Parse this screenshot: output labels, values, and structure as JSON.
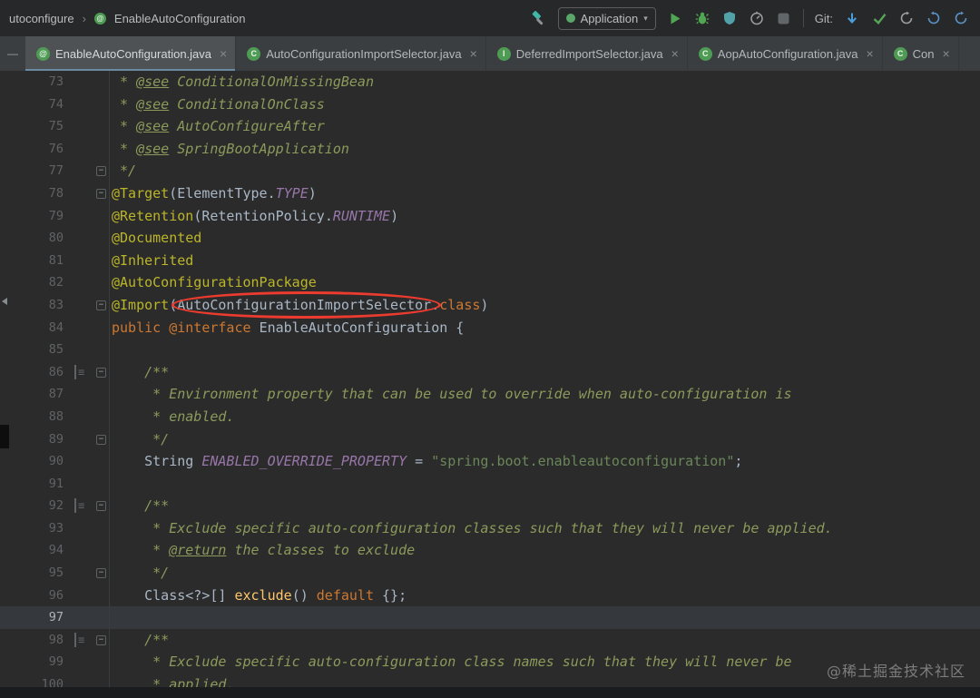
{
  "toolbar": {
    "breadcrumb_parent": "utoconfigure",
    "breadcrumb_separator": "›",
    "breadcrumb_icon_letter": "@",
    "breadcrumb_current": "EnableAutoConfiguration",
    "run_config_label": "Application",
    "run_config_chevron": "▾",
    "git_label": "Git:",
    "icons": [
      "build-hammer-icon",
      "run-icon",
      "debug-icon",
      "coverage-icon",
      "profiler-icon",
      "stop-icon",
      "git-update-icon",
      "git-commit-check-icon",
      "history-icon",
      "rollback-icon",
      "refresh-icon"
    ]
  },
  "tabbar": {
    "hide_dash": "—",
    "close_glyph": "×",
    "tabs": [
      {
        "label": "EnableAutoConfiguration.java",
        "icon": "@",
        "active": true
      },
      {
        "label": "AutoConfigurationImportSelector.java",
        "icon": "C",
        "active": false
      },
      {
        "label": "DeferredImportSelector.java",
        "icon": "I",
        "active": false
      },
      {
        "label": "AopAutoConfiguration.java",
        "icon": "C",
        "active": false
      },
      {
        "label": "Con",
        "icon": "C",
        "active": false
      }
    ]
  },
  "editor": {
    "current_line": 97,
    "lines": [
      {
        "n": 73,
        "tokens": [
          [
            " * ",
            "com"
          ],
          [
            "@see",
            "doctag"
          ],
          [
            " ConditionalOnMissingBean",
            "com"
          ]
        ]
      },
      {
        "n": 74,
        "tokens": [
          [
            " * ",
            "com"
          ],
          [
            "@see",
            "doctag"
          ],
          [
            " ConditionalOnClass",
            "com"
          ]
        ]
      },
      {
        "n": 75,
        "tokens": [
          [
            " * ",
            "com"
          ],
          [
            "@see",
            "doctag"
          ],
          [
            " AutoConfigureAfter",
            "com"
          ]
        ]
      },
      {
        "n": 76,
        "tokens": [
          [
            " * ",
            "com"
          ],
          [
            "@see",
            "doctag"
          ],
          [
            " SpringBootApplication",
            "com"
          ]
        ]
      },
      {
        "n": 77,
        "tokens": [
          [
            " */",
            "com"
          ]
        ],
        "fold": "end"
      },
      {
        "n": 78,
        "tokens": [
          [
            "@Target",
            "ann"
          ],
          [
            "(",
            "pln"
          ],
          [
            "ElementType",
            "pln"
          ],
          [
            ".",
            "pln"
          ],
          [
            "TYPE",
            "const"
          ],
          [
            ")",
            "pln"
          ]
        ],
        "fold": "start"
      },
      {
        "n": 79,
        "tokens": [
          [
            "@Retention",
            "ann"
          ],
          [
            "(",
            "pln"
          ],
          [
            "RetentionPolicy",
            "pln"
          ],
          [
            ".",
            "pln"
          ],
          [
            "RUNTIME",
            "const"
          ],
          [
            ")",
            "pln"
          ]
        ]
      },
      {
        "n": 80,
        "tokens": [
          [
            "@Documented",
            "ann"
          ]
        ]
      },
      {
        "n": 81,
        "tokens": [
          [
            "@Inherited",
            "ann"
          ]
        ]
      },
      {
        "n": 82,
        "tokens": [
          [
            "@AutoConfigurationPackage",
            "ann"
          ]
        ]
      },
      {
        "n": 83,
        "tokens": [
          [
            "@Import",
            "ann"
          ],
          [
            "(",
            "pln"
          ],
          [
            "AutoConfigurationImportSelector",
            "pln"
          ],
          [
            ".",
            "pln"
          ],
          [
            "class",
            "kw"
          ],
          [
            ")",
            "pln"
          ]
        ],
        "fold": "end"
      },
      {
        "n": 84,
        "tokens": [
          [
            "public @interface ",
            "kw"
          ],
          [
            "EnableAutoConfiguration {",
            "pln"
          ]
        ]
      },
      {
        "n": 85,
        "tokens": []
      },
      {
        "n": 86,
        "tokens": [
          [
            "    /**",
            "com"
          ]
        ],
        "fold": "start",
        "doc": true
      },
      {
        "n": 87,
        "tokens": [
          [
            "     * Environment property that can be used to override when auto-configuration is",
            "com"
          ]
        ]
      },
      {
        "n": 88,
        "tokens": [
          [
            "     * enabled.",
            "com"
          ]
        ]
      },
      {
        "n": 89,
        "tokens": [
          [
            "     */",
            "com"
          ]
        ],
        "fold": "end"
      },
      {
        "n": 90,
        "tokens": [
          [
            "    String ",
            "pln"
          ],
          [
            "ENABLED_OVERRIDE_PROPERTY",
            "const"
          ],
          [
            " = ",
            "pln"
          ],
          [
            "\"spring.boot.enableautoconfiguration\"",
            "str"
          ],
          [
            ";",
            "pln"
          ]
        ]
      },
      {
        "n": 91,
        "tokens": []
      },
      {
        "n": 92,
        "tokens": [
          [
            "    /**",
            "com"
          ]
        ],
        "fold": "start",
        "doc": true
      },
      {
        "n": 93,
        "tokens": [
          [
            "     * Exclude specific auto-configuration classes such that they will never be applied.",
            "com"
          ]
        ]
      },
      {
        "n": 94,
        "tokens": [
          [
            "     * ",
            "com"
          ],
          [
            "@return",
            "doctag"
          ],
          [
            " the classes to exclude",
            "com"
          ]
        ]
      },
      {
        "n": 95,
        "tokens": [
          [
            "     */",
            "com"
          ]
        ],
        "fold": "end"
      },
      {
        "n": 96,
        "tokens": [
          [
            "    Class<?>[] ",
            "pln"
          ],
          [
            "exclude",
            "fn"
          ],
          [
            "() ",
            "pln"
          ],
          [
            "default",
            "kw"
          ],
          [
            " {};",
            "pln"
          ]
        ]
      },
      {
        "n": 97,
        "tokens": [],
        "hl": true
      },
      {
        "n": 98,
        "tokens": [
          [
            "    /**",
            "com"
          ]
        ],
        "fold": "start",
        "doc": true
      },
      {
        "n": 99,
        "tokens": [
          [
            "     * Exclude specific auto-configuration class names such that they will never be",
            "com"
          ]
        ]
      },
      {
        "n": 100,
        "tokens": [
          [
            "     * applied.",
            "com"
          ]
        ]
      }
    ]
  },
  "annotation": {
    "type": "ellipse",
    "color": "#ed3b2f",
    "around": "AutoConfigurationImportSelector",
    "line": 83
  },
  "watermark": "@稀土掘金技术社区",
  "colors": {
    "editor_bg": "#2b2b2b",
    "tabbar_bg": "#3b3e40",
    "toolbar_bg": "#26282a",
    "annotation_yellow": "#bbb529",
    "keyword_orange": "#cc7832",
    "string_green": "#6a8759",
    "comment_olive": "#8c9a5b",
    "constant_purple": "#9876aa",
    "method_yellow": "#ffc66b",
    "plain_text": "#a9b7c6",
    "line_number": "#606366",
    "red_ellipse": "#ed3b2f"
  }
}
